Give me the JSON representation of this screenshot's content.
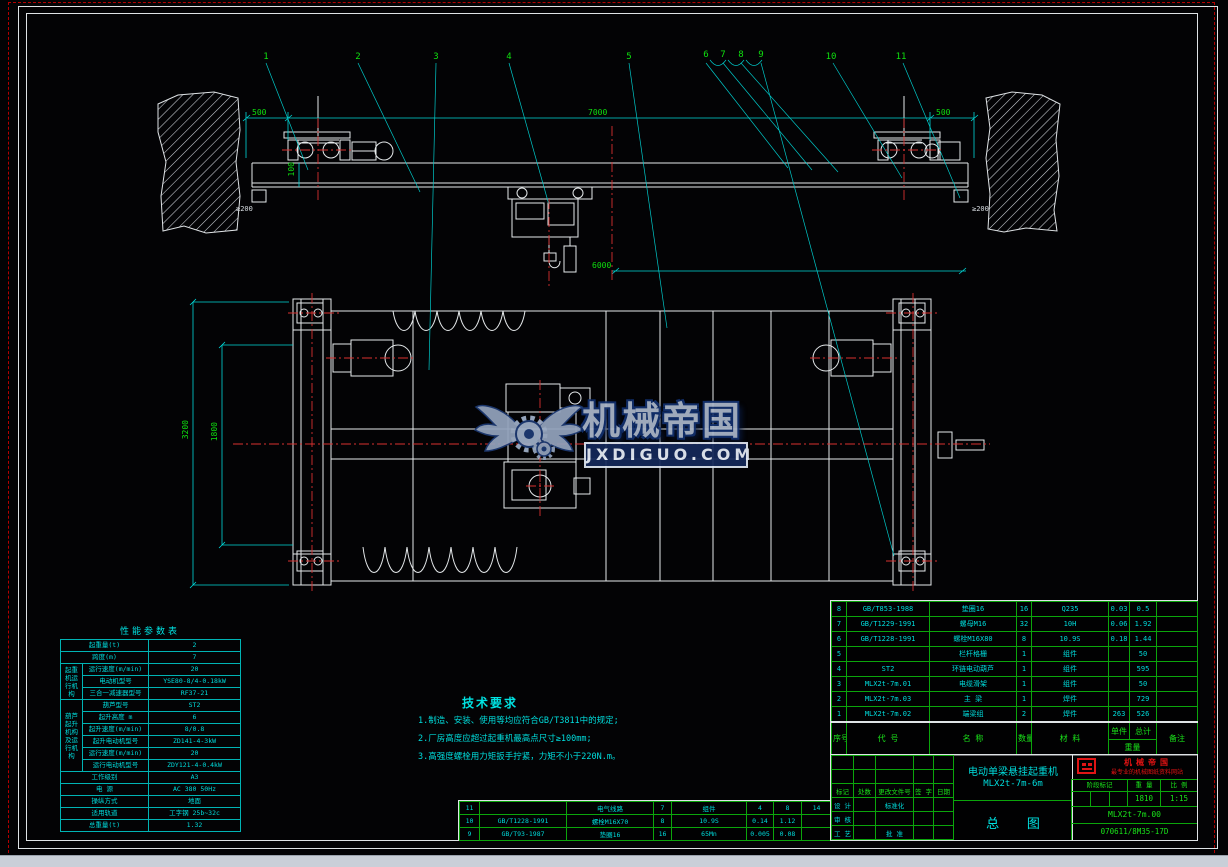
{
  "watermark": {
    "brand": "机械帝国",
    "site": "JXDIGUO.COM"
  },
  "callouts": [
    "1",
    "2",
    "3",
    "4",
    "5",
    "6",
    "7",
    "8",
    "9",
    "10",
    "11"
  ],
  "dims": {
    "left500": "500",
    "span": "7000",
    "right500": "500",
    "h6000": "6000",
    "g100": "100",
    "w3200": "3200",
    "w1800": "1800",
    "clearL": "≥200",
    "clearR": "≥200"
  },
  "tech": {
    "title": "技术要求",
    "l1": "1.制造、安装、使用等均应符合GB/T3811中的规定;",
    "l2": "2.厂房高度应超过起重机最高点尺寸≥100mm;",
    "l3": "3.高强度螺栓用力矩扳手拧紧，力矩不小于220N.m。"
  },
  "pt": {
    "title": "性能参数表",
    "g1": "起重机运行机构",
    "g2": "葫芦起升机构及运行机构",
    "r": [
      [
        "起重量(t)",
        "2"
      ],
      [
        "跨度(m)",
        "7"
      ],
      [
        "运行速度(m/min)",
        "20"
      ],
      [
        "电动机型号",
        "YSE80-8/4-0.18kW"
      ],
      [
        "三合一减速器型号",
        "RF37-21"
      ],
      [
        "葫芦型号",
        "ST2"
      ],
      [
        "起升高度 m",
        "6"
      ],
      [
        "起升速度(m/min)",
        "8/0.8"
      ],
      [
        "起升电动机型号",
        "ZD141-4-3kW"
      ],
      [
        "运行速度(m/min)",
        "20"
      ],
      [
        "运行电动机型号",
        "ZDY121-4-0.4kW"
      ],
      [
        "工作级别",
        "A3"
      ],
      [
        "电  源",
        "AC 380 50Hz"
      ],
      [
        "操纵方式",
        "地面"
      ],
      [
        "适用轨道",
        "工字钢 25b~32c"
      ],
      [
        "总重量(t)",
        "1.32"
      ]
    ]
  },
  "bom": {
    "headers": {
      "no": "序号",
      "code": "代  号",
      "name": "名  称",
      "qty": "数量",
      "mat": "材  料",
      "unit": "单件",
      "total": "总计",
      "weight": "重量",
      "note": "备注"
    },
    "rows": [
      {
        "no": "8",
        "code": "GB/T853-1988",
        "name": "垫圈16",
        "qty": "16",
        "mat": "Q235",
        "unit": "0.03",
        "total": "0.5",
        "note": ""
      },
      {
        "no": "7",
        "code": "GB/T1229-1991",
        "name": "螺母M16",
        "qty": "32",
        "mat": "10H",
        "unit": "0.06",
        "total": "1.92",
        "note": ""
      },
      {
        "no": "6",
        "code": "GB/T1228-1991",
        "name": "螺栓M16X80",
        "qty": "8",
        "mat": "10.9S",
        "unit": "0.18",
        "total": "1.44",
        "note": ""
      },
      {
        "no": "5",
        "code": "",
        "name": "栏杆格栅",
        "qty": "1",
        "mat": "组件",
        "unit": "",
        "total": "50",
        "note": ""
      },
      {
        "no": "4",
        "code": "ST2",
        "name": "环链电动葫芦",
        "qty": "1",
        "mat": "组件",
        "unit": "",
        "total": "595",
        "note": ""
      },
      {
        "no": "3",
        "code": "MLX2t-7m.01",
        "name": "电缆滑架",
        "qty": "1",
        "mat": "组件",
        "unit": "",
        "total": "50",
        "note": ""
      },
      {
        "no": "2",
        "code": "MLX2t-7m.03",
        "name": "主  梁",
        "qty": "1",
        "mat": "焊件",
        "unit": "",
        "total": "729",
        "note": ""
      },
      {
        "no": "1",
        "code": "MLX2t-7m.02",
        "name": "端梁组",
        "qty": "2",
        "mat": "焊件",
        "unit": "263",
        "total": "526",
        "note": ""
      }
    ],
    "strip": [
      {
        "no": "11",
        "code": "",
        "name": "电气线路",
        "qty": "7",
        "mat": "组件",
        "unit": "4",
        "total": "8",
        "note": "14"
      },
      {
        "no": "10",
        "code": "GB/T1228-1991",
        "name": "螺栓M16X70",
        "qty": "8",
        "mat": "10.9S",
        "unit": "0.14",
        "total": "1.12",
        "note": ""
      },
      {
        "no": "9",
        "code": "GB/T93-1987",
        "name": "垫圈16",
        "qty": "16",
        "mat": "65Mn",
        "unit": "0.005",
        "total": "0.08",
        "note": ""
      }
    ]
  },
  "tb": {
    "product": "电动单梁悬挂起重机",
    "model": "MLX2t-7m-6m",
    "sheet": "总  图",
    "dwg_no": "MLX2t-7m.00",
    "code": "070611/8M35-17D",
    "stage": "阶段标记",
    "weight_label": "重 量",
    "scale_label": "比 例",
    "weight": "1810",
    "scale": "1:15",
    "rev": [
      "标记",
      "处数",
      "更改文件号",
      "签 字",
      "日期"
    ],
    "roles": {
      "design": "设 计",
      "std": "标准化",
      "check": "审 核",
      "process": "工 艺",
      "approve": "批 准"
    },
    "brand": "机械帝国",
    "tagline": "最专业的机械图纸资料网站"
  }
}
